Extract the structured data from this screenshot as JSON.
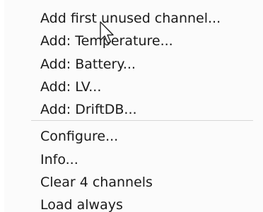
{
  "menu": {
    "items": [
      {
        "label": "Add first unused channel..."
      },
      {
        "label": "Add: Temperature..."
      },
      {
        "label": "Add: Battery..."
      },
      {
        "label": "Add: LV..."
      },
      {
        "label": "Add: DriftDB..."
      },
      {
        "label": "Configure..."
      },
      {
        "label": "Info..."
      },
      {
        "label": "Clear 4 channels"
      },
      {
        "label": "Load always"
      }
    ]
  },
  "cursor": {
    "icon": "mouse-pointer-icon"
  }
}
